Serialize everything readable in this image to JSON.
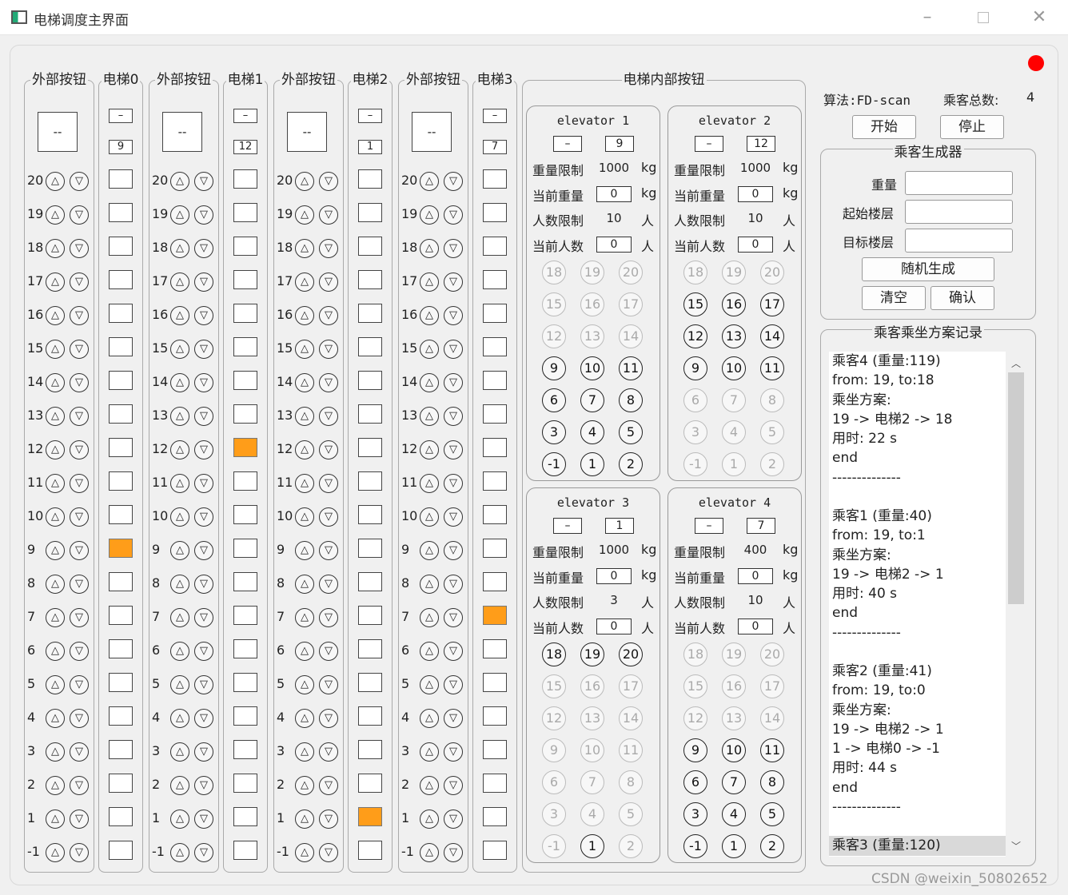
{
  "window": {
    "title": "电梯调度主界面"
  },
  "external_title": "外部按钮",
  "elevator_titles": [
    "电梯0",
    "电梯1",
    "电梯2",
    "电梯3"
  ],
  "floors": [
    "20",
    "19",
    "18",
    "17",
    "16",
    "15",
    "14",
    "13",
    "12",
    "11",
    "10",
    "9",
    "8",
    "7",
    "6",
    "5",
    "4",
    "3",
    "2",
    "1",
    "-1"
  ],
  "big_display": [
    "--",
    "--",
    "--",
    "--"
  ],
  "shafts": [
    {
      "dir": "–",
      "floor": "9",
      "current_floor": "9"
    },
    {
      "dir": "–",
      "floor": "12",
      "current_floor": "12"
    },
    {
      "dir": "–",
      "floor": "1",
      "current_floor": "1"
    },
    {
      "dir": "–",
      "floor": "7",
      "current_floor": "7"
    }
  ],
  "up_icon": "triangle-up",
  "down_icon": "triangle-down",
  "inner_title": "电梯内部按钮",
  "labels": {
    "weight_limit": "重量限制",
    "cur_weight": "当前重量",
    "people_limit": "人数限制",
    "cur_people": "当前人数",
    "kg": "kg",
    "ren": "人"
  },
  "panels": [
    {
      "title": "elevator 1",
      "dir": "–",
      "floor": "9",
      "weight_limit": "1000",
      "cur_weight": "0",
      "people_limit": "10",
      "cur_people": "0",
      "buttons": [
        [
          "18",
          "19",
          "20"
        ],
        [
          "15",
          "16",
          "17"
        ],
        [
          "12",
          "13",
          "14"
        ],
        [
          "9",
          "10",
          "11"
        ],
        [
          "6",
          "7",
          "8"
        ],
        [
          "3",
          "4",
          "5"
        ],
        [
          "-1",
          "1",
          "2"
        ]
      ],
      "enabled": [
        [
          0,
          0,
          0
        ],
        [
          0,
          0,
          0
        ],
        [
          0,
          0,
          0
        ],
        [
          1,
          1,
          1
        ],
        [
          1,
          1,
          1
        ],
        [
          1,
          1,
          1
        ],
        [
          1,
          1,
          1
        ]
      ]
    },
    {
      "title": "elevator 2",
      "dir": "–",
      "floor": "12",
      "weight_limit": "1000",
      "cur_weight": "0",
      "people_limit": "10",
      "cur_people": "0",
      "buttons": [
        [
          "18",
          "19",
          "20"
        ],
        [
          "15",
          "16",
          "17"
        ],
        [
          "12",
          "13",
          "14"
        ],
        [
          "9",
          "10",
          "11"
        ],
        [
          "6",
          "7",
          "8"
        ],
        [
          "3",
          "4",
          "5"
        ],
        [
          "-1",
          "1",
          "2"
        ]
      ],
      "enabled": [
        [
          0,
          0,
          0
        ],
        [
          1,
          1,
          1
        ],
        [
          1,
          1,
          1
        ],
        [
          1,
          1,
          1
        ],
        [
          0,
          0,
          0
        ],
        [
          0,
          0,
          0
        ],
        [
          0,
          0,
          0
        ]
      ]
    },
    {
      "title": "elevator 3",
      "dir": "–",
      "floor": "1",
      "weight_limit": "1000",
      "cur_weight": "0",
      "people_limit": "3",
      "cur_people": "0",
      "buttons": [
        [
          "18",
          "19",
          "20"
        ],
        [
          "15",
          "16",
          "17"
        ],
        [
          "12",
          "13",
          "14"
        ],
        [
          "9",
          "10",
          "11"
        ],
        [
          "6",
          "7",
          "8"
        ],
        [
          "3",
          "4",
          "5"
        ],
        [
          "-1",
          "1",
          "2"
        ]
      ],
      "enabled": [
        [
          1,
          1,
          1
        ],
        [
          0,
          0,
          0
        ],
        [
          0,
          0,
          0
        ],
        [
          0,
          0,
          0
        ],
        [
          0,
          0,
          0
        ],
        [
          0,
          0,
          0
        ],
        [
          0,
          1,
          0
        ]
      ]
    },
    {
      "title": "elevator 4",
      "dir": "–",
      "floor": "7",
      "weight_limit": "400",
      "cur_weight": "0",
      "people_limit": "10",
      "cur_people": "0",
      "buttons": [
        [
          "18",
          "19",
          "20"
        ],
        [
          "15",
          "16",
          "17"
        ],
        [
          "12",
          "13",
          "14"
        ],
        [
          "9",
          "10",
          "11"
        ],
        [
          "6",
          "7",
          "8"
        ],
        [
          "3",
          "4",
          "5"
        ],
        [
          "-1",
          "1",
          "2"
        ]
      ],
      "enabled": [
        [
          0,
          0,
          0
        ],
        [
          0,
          0,
          0
        ],
        [
          0,
          0,
          0
        ],
        [
          1,
          1,
          1
        ],
        [
          1,
          1,
          1
        ],
        [
          1,
          1,
          1
        ],
        [
          1,
          1,
          1
        ]
      ]
    }
  ],
  "algo": {
    "label": "算法:FD-scan",
    "total_label": "乘客总数:",
    "total": "4"
  },
  "controls": {
    "start": "开始",
    "stop": "停止"
  },
  "generator": {
    "title": "乘客生成器",
    "weight": "重量",
    "start_floor": "起始楼层",
    "target_floor": "目标楼层",
    "random": "随机生成",
    "clear": "清空",
    "confirm": "确认"
  },
  "log": {
    "title": "乘客乘坐方案记录",
    "lines": [
      "乘客4 (重量:119)",
      "from: 19, to:18",
      "乘坐方案:",
      "19 -> 电梯2 -> 18",
      "用时: 22 s",
      "end",
      "--------------",
      "",
      "乘客1 (重量:40)",
      "from: 19, to:1",
      "乘坐方案:",
      "19 -> 电梯2 -> 1",
      "用时: 40 s",
      "end",
      "--------------",
      "",
      "乘客2 (重量:41)",
      "from: 19, to:0",
      "乘坐方案:",
      "19 -> 电梯2 -> 1",
      "1 -> 电梯0 -> -1",
      "用时: 44 s",
      "end",
      "--------------",
      "",
      "乘客3 (重量:120)"
    ]
  },
  "watermark": "CSDN @weixin_50802652",
  "colors": {
    "active_floor": "#ff9d19",
    "status": "#ff0000"
  }
}
